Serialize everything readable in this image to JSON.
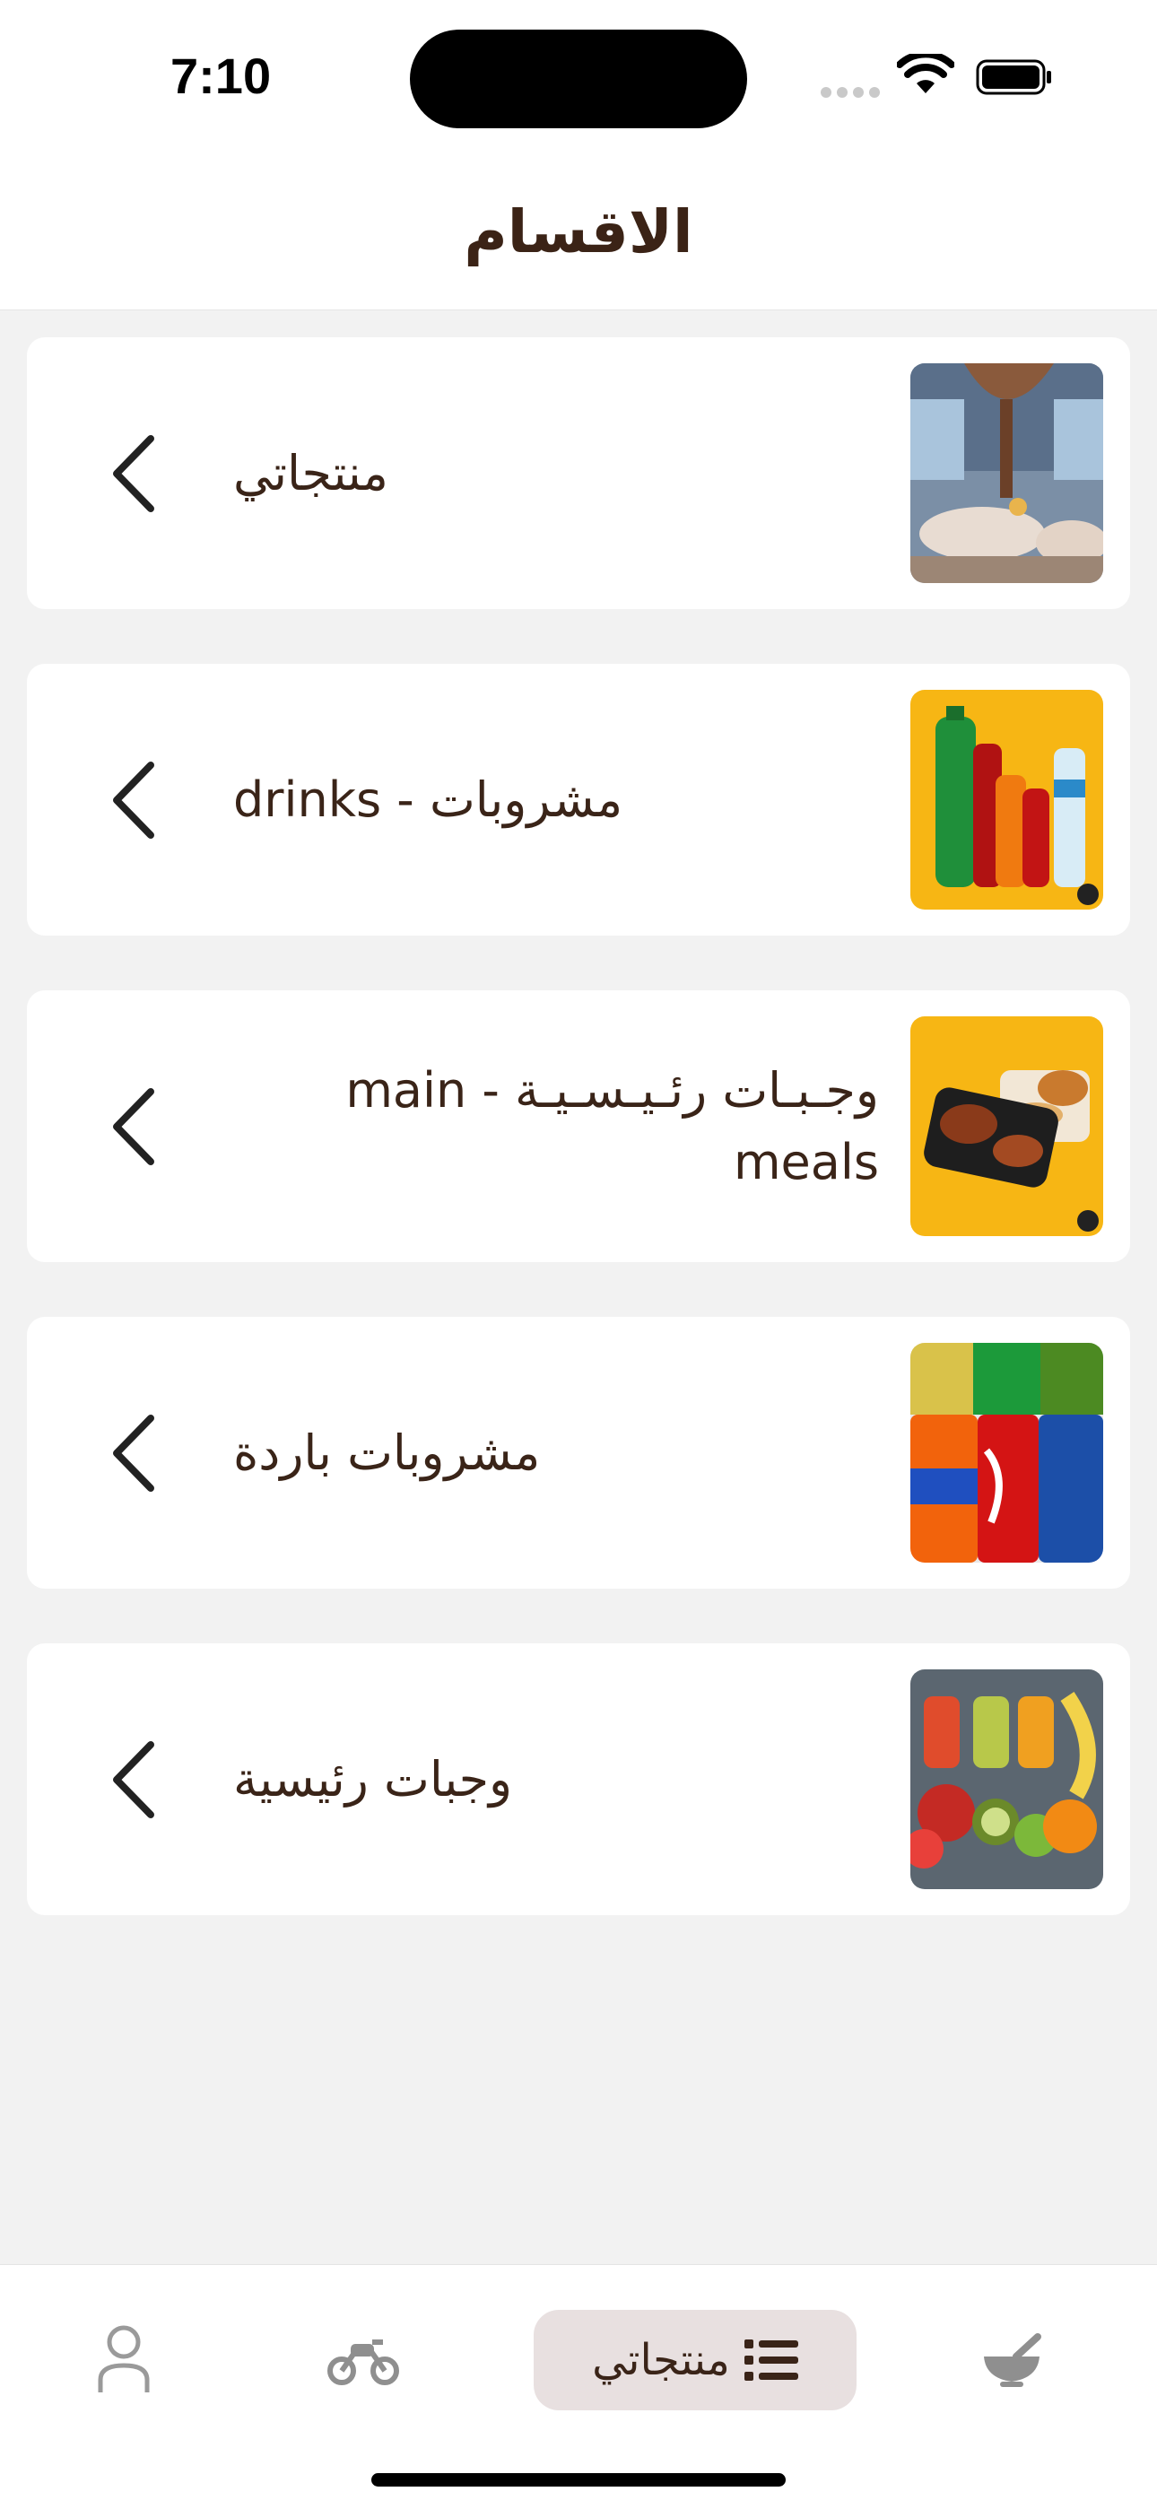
{
  "status_bar": {
    "time": "7:10"
  },
  "header": {
    "title": "الاقسام"
  },
  "categories": [
    {
      "label": "منتجاتي",
      "image": "restaurant-interior"
    },
    {
      "label": "مشروبات - drinks",
      "image": "soda-bottles"
    },
    {
      "label": "وجـبـات رئـيـسـيـة - main meals",
      "image": "meal-box"
    },
    {
      "label": "مشروبات باردة",
      "image": "soda-cans"
    },
    {
      "label": "وجبات رئيسية",
      "image": "fruits-juices"
    }
  ],
  "tabbar": {
    "active_label": "منتجاتي",
    "icons": [
      "profile-icon",
      "motorcycle-icon",
      "list-icon",
      "mortar-icon"
    ]
  },
  "colors": {
    "text": "#3a2418",
    "background": "#f2f2f2",
    "active_tab": "#e8e0e0"
  }
}
